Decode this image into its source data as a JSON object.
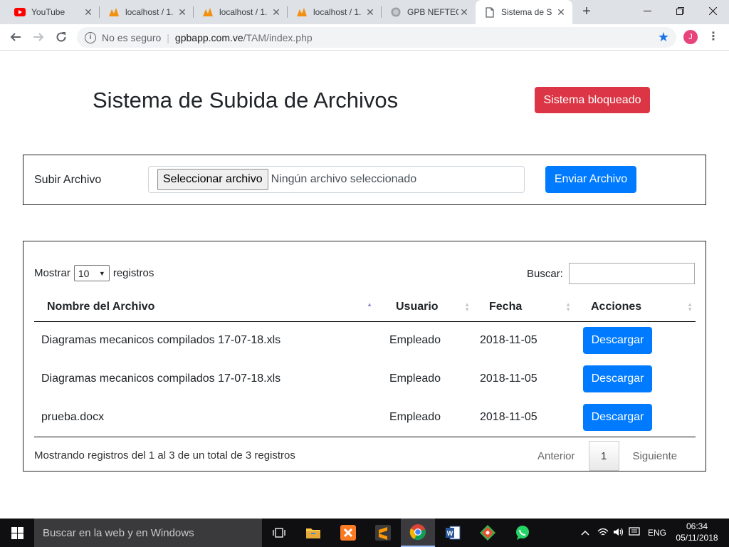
{
  "browser": {
    "tabs": [
      {
        "title": "YouTube",
        "icon": "youtube-icon",
        "active": false
      },
      {
        "title": "localhost / 1.",
        "icon": "phpmyadmin-icon",
        "active": false
      },
      {
        "title": "localhost / 1.",
        "icon": "phpmyadmin-icon",
        "active": false
      },
      {
        "title": "localhost / 1.",
        "icon": "phpmyadmin-icon",
        "active": false
      },
      {
        "title": "GPB NEFTEG",
        "icon": "globe-icon",
        "active": false
      },
      {
        "title": "Sistema de S",
        "icon": "document-icon",
        "active": true
      }
    ],
    "address": {
      "security_label": "No es seguro",
      "host": "gpbapp.com.ve",
      "path": "/TAM/index.php"
    },
    "profile_initial": "J"
  },
  "page": {
    "title": "Sistema de Subida de Archivos",
    "locked_button": "Sistema bloqueado",
    "upload": {
      "label": "Subir Archivo",
      "choose_button": "Seleccionar archivo",
      "no_file_text": "Ningún archivo seleccionado",
      "submit_button": "Enviar Archivo"
    },
    "table": {
      "length_prefix": "Mostrar",
      "length_value": "10",
      "length_suffix": "registros",
      "search_label": "Buscar:",
      "columns": [
        "Nombre del Archivo",
        "Usuario",
        "Fecha",
        "Acciones"
      ],
      "rows": [
        {
          "name": "Diagramas mecanicos compilados 17-07-18.xls",
          "user": "Empleado",
          "date": "2018-11-05",
          "action": "Descargar"
        },
        {
          "name": "Diagramas mecanicos compilados 17-07-18.xls",
          "user": "Empleado",
          "date": "2018-11-05",
          "action": "Descargar"
        },
        {
          "name": "prueba.docx",
          "user": "Empleado",
          "date": "2018-11-05",
          "action": "Descargar"
        }
      ],
      "info": "Mostrando registros del 1 al 3 de un total de 3 registros",
      "pagination": {
        "prev": "Anterior",
        "current": "1",
        "next": "Siguiente"
      }
    }
  },
  "taskbar": {
    "search_placeholder": "Buscar en la web y en Windows",
    "apps": [
      "task-view-icon",
      "file-explorer-icon",
      "xampp-icon",
      "sublime-text-icon",
      "chrome-icon",
      "word-icon",
      "git-icon",
      "whatsapp-icon"
    ],
    "language": "ENG",
    "time": "06:34",
    "date": "05/11/2018"
  },
  "colors": {
    "primary": "#007bff",
    "danger": "#dc3545"
  }
}
